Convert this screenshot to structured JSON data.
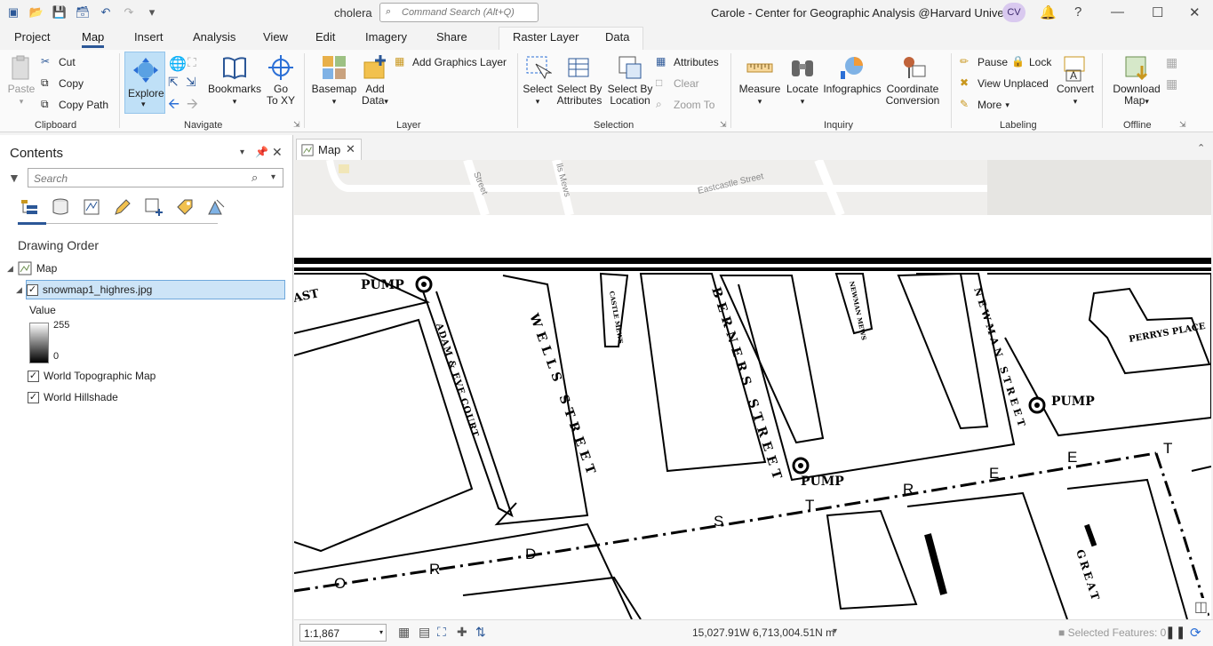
{
  "app": {
    "project_name": "cholera",
    "command_search_placeholder": "Command Search (Alt+Q)",
    "user_title": "Carole - Center for Geographic Analysis @Harvard University",
    "user_initials": "CV"
  },
  "tabs": [
    {
      "label": "Project"
    },
    {
      "label": "Map"
    },
    {
      "label": "Insert"
    },
    {
      "label": "Analysis"
    },
    {
      "label": "View"
    },
    {
      "label": "Edit"
    },
    {
      "label": "Imagery"
    },
    {
      "label": "Share"
    },
    {
      "label": "Raster Layer"
    },
    {
      "label": "Data"
    }
  ],
  "ribbon": {
    "clipboard": {
      "label": "Clipboard",
      "paste": "Paste",
      "cut": "Cut",
      "copy": "Copy",
      "copy_path": "Copy Path"
    },
    "navigate": {
      "label": "Navigate",
      "explore": "Explore",
      "bookmarks": "Bookmarks",
      "goto": "Go",
      "goto2": "To XY"
    },
    "layer": {
      "label": "Layer",
      "basemap": "Basemap",
      "add_data": "Add",
      "add_data2": "Data",
      "add_graphics": "Add Graphics Layer"
    },
    "selection": {
      "label": "Selection",
      "select": "Select",
      "by_attr": "Select By",
      "by_attr2": "Attributes",
      "by_loc": "Select By",
      "by_loc2": "Location",
      "attributes": "Attributes",
      "clear": "Clear",
      "zoom_to": "Zoom To"
    },
    "inquiry": {
      "label": "Inquiry",
      "measure": "Measure",
      "locate": "Locate",
      "infographics": "Infographics",
      "coord": "Coordinate",
      "coord2": "Conversion"
    },
    "labeling": {
      "label": "Labeling",
      "pause": "Pause",
      "lock": "Lock",
      "view_unplaced": "View Unplaced",
      "more": "More",
      "convert": "Convert"
    },
    "offline": {
      "label": "Offline",
      "download": "Download",
      "download2": "Map"
    }
  },
  "contents": {
    "title": "Contents",
    "search_placeholder": "Search",
    "drawing_order": "Drawing Order",
    "layers": {
      "map": "Map",
      "raster": "snowmap1_highres.jpg",
      "value_label": "Value",
      "value_max": "255",
      "value_min": "0",
      "topo": "World Topographic Map",
      "hillshade": "World Hillshade"
    }
  },
  "map_tab": {
    "label": "Map"
  },
  "map_labels": {
    "street1": "Street",
    "mews1": "lls Mews",
    "eastcastle": "Eastcastle Street",
    "pump": "PUMP",
    "pump_full": "PUMP",
    "wells": "WELLS STREET",
    "berners": "BERNERS STREET",
    "newman": "NEWMAN STREET",
    "castle_mews": "CASTLE MEWS",
    "newman_mews": "NEWMAN MEWS",
    "adam_eve": "ADAM & EVE COURT",
    "perrys": "PERRYS PLACE",
    "oxford_letters": [
      "O",
      "R",
      "D",
      "S",
      "T",
      "R",
      "E",
      "E",
      "T"
    ],
    "great": "GREAT",
    "ast": "AST"
  },
  "status": {
    "scale": "1:1,867",
    "coords": "15,027.91W 6,713,004.51N m",
    "selected": "Selected Features: 0"
  }
}
